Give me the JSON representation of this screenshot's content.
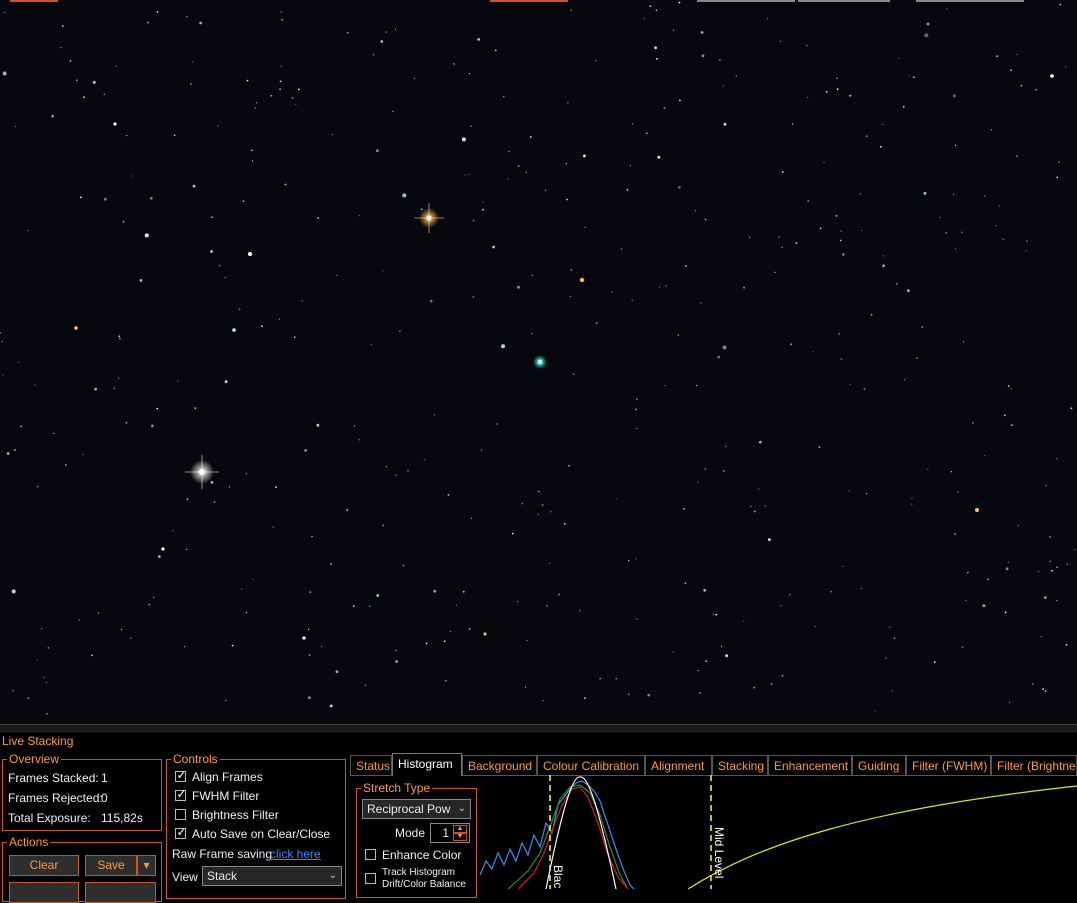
{
  "panel": {
    "title": "Live Stacking"
  },
  "overview": {
    "legend": "Overview",
    "frames_stacked_label": "Frames Stacked:",
    "frames_stacked_value": "1",
    "frames_rejected_label": "Frames Rejected:",
    "frames_rejected_value": "0",
    "total_exposure_label": "Total Exposure:",
    "total_exposure_value": "115,82s"
  },
  "actions": {
    "legend": "Actions",
    "clear_label": "Clear",
    "save_label": "Save"
  },
  "controls": {
    "legend": "Controls",
    "align_frames": {
      "label": "Align Frames",
      "checked": true
    },
    "fwhm_filter": {
      "label": "FWHM Filter",
      "checked": true
    },
    "brightness_filter": {
      "label": "Brightness Filter",
      "checked": false
    },
    "auto_save": {
      "label": "Auto Save on Clear/Close",
      "checked": true
    },
    "raw_saving_label": "Raw Frame saving",
    "raw_saving_link": "click here",
    "view_label": "View",
    "view_value": "Stack"
  },
  "tabs": [
    "Status",
    "Histogram",
    "Background",
    "Colour Calibration",
    "Alignment",
    "Stacking",
    "Enhancement",
    "Guiding",
    "Filter (FWHM)",
    "Filter (Brightness)"
  ],
  "active_tab": "Histogram",
  "stretch": {
    "legend": "Stretch Type",
    "type_value": "Reciprocal Pow",
    "mode_label": "Mode",
    "mode_value": "1",
    "enhance_color_label": "Enhance Color",
    "track_label_line1": "Track Histogram",
    "track_label_line2": "Drift/Color Balance"
  },
  "histogram": {
    "black_marker_label": "Black",
    "mid_marker_label": "Mid Level"
  },
  "colors": {
    "accent": "#ff9a3c",
    "border": "#c8581c",
    "link": "#2b8cff",
    "curve": "#e6e61a",
    "marker": "#ffff33"
  }
}
